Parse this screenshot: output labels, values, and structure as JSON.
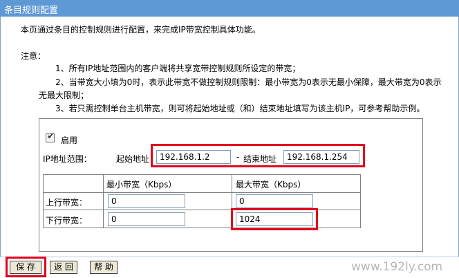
{
  "window": {
    "title": "条目规则配置"
  },
  "intro": "本页通过条目的控制规则进行配置，来完成IP带宽控制具体功能。",
  "notes": {
    "title": "注意：",
    "items": [
      "1、所有IP地址范围内的客户端将共享宽带控制规则所设定的带宽；",
      "2、当带宽大小填为0时，表示此带宽不做控制规则限制：最小带宽为0表示无最小保障，最大带宽为0表示",
      "无最大限制；",
      "3、若只需控制单台主机带宽，则可将起始地址或（和）结束地址填写为该主机IP，可参考帮助示例。"
    ]
  },
  "form": {
    "enable_label": "启用",
    "enabled": true,
    "ip_range_label": "IP地址范围：",
    "start_label": "起始地址",
    "start_value": "192.168.1.2",
    "dash": "-",
    "end_label": "结束地址",
    "end_value": "192.168.1.254"
  },
  "table": {
    "col_min": "最小带宽（Kbps）",
    "col_max": "最大带宽（Kbps）",
    "rows": [
      {
        "label": "上行带宽：",
        "min": "0",
        "max": "0"
      },
      {
        "label": "下行带宽：",
        "min": "0",
        "max": "1024"
      }
    ]
  },
  "buttons": {
    "save": "保 存",
    "back": "返 回",
    "help": "帮 助"
  },
  "watermark": "www.192ly.com",
  "colors": {
    "title_bg": "#5e99d6",
    "highlight": "#e3001b"
  }
}
